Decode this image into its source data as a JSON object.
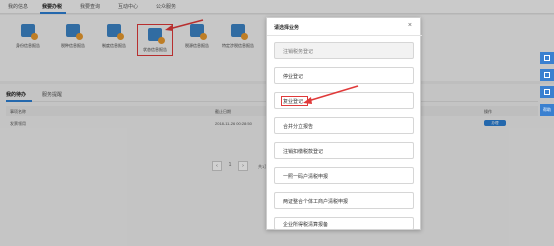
{
  "topnav": {
    "tabs": [
      {
        "label": "我的信息"
      },
      {
        "label": "我要办税"
      },
      {
        "label": "我要查询"
      },
      {
        "label": "互动中心"
      },
      {
        "label": "公众服务"
      }
    ]
  },
  "tiles": [
    {
      "label": "身份信息报告",
      "icon": "document-icon"
    },
    {
      "label": "税种信息报告",
      "icon": "document-icon"
    },
    {
      "label": "制度信息报告",
      "icon": "document-icon"
    },
    {
      "label": "状态信息报告",
      "icon": "document-icon"
    },
    {
      "label": "税源信息报告",
      "icon": "document-icon"
    },
    {
      "label": "特定涉税信息报告",
      "icon": "document-icon"
    }
  ],
  "lower": {
    "tabs": [
      {
        "label": "我的待办"
      },
      {
        "label": "服务提醒"
      }
    ],
    "table": {
      "headers": [
        "事项名称",
        "截止日期",
        "操作"
      ],
      "row": {
        "name": "发票领用",
        "date": "2018-11-26 00:28:50",
        "action": "办理"
      }
    },
    "pager": {
      "prev": "‹",
      "page": "1",
      "next": "›",
      "summary": "共1页"
    }
  },
  "side": {
    "text": "帮助"
  },
  "modal": {
    "title": "请选择业务",
    "close": "×",
    "items": [
      {
        "label": "注销税务登记",
        "disabled": true
      },
      {
        "label": "停业登记",
        "disabled": false
      },
      {
        "label": "复业登记",
        "disabled": false,
        "highlighted": true
      },
      {
        "label": "合并分立报告",
        "disabled": false
      },
      {
        "label": "注销扣缴税款登记",
        "disabled": false
      },
      {
        "label": "一照一码户清税申报",
        "disabled": false
      },
      {
        "label": "两证整合个体工商户清税申报",
        "disabled": false
      },
      {
        "label": "企业所得税清算报备",
        "disabled": false
      }
    ]
  },
  "colors": {
    "accent": "#2d7fd3",
    "highlight": "#e03a3a"
  }
}
